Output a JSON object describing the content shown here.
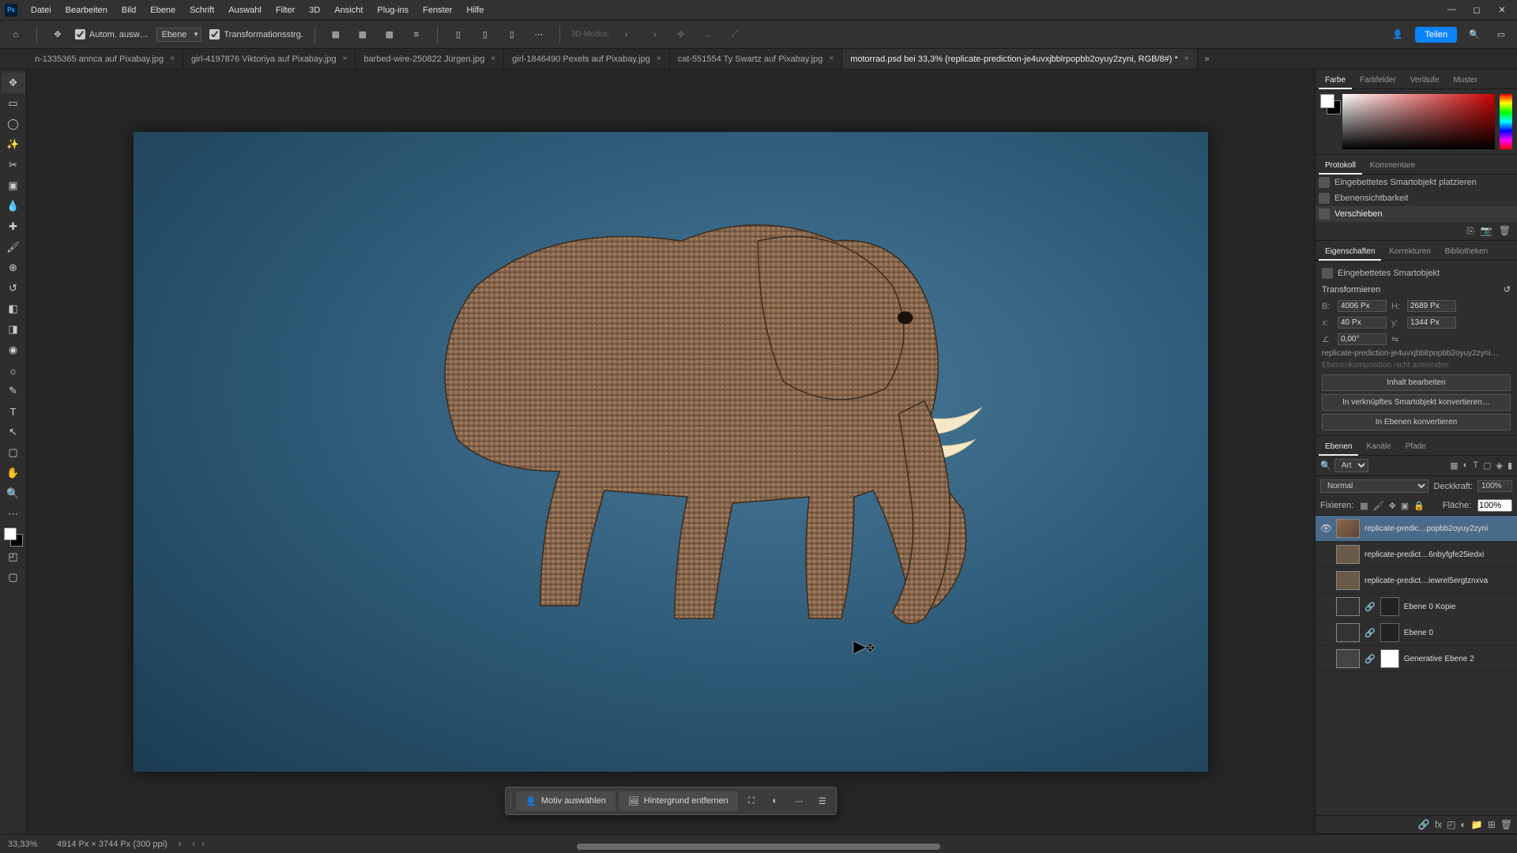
{
  "menu": [
    "Datei",
    "Bearbeiten",
    "Bild",
    "Ebene",
    "Schrift",
    "Auswahl",
    "Filter",
    "3D",
    "Ansicht",
    "Plug-ins",
    "Fenster",
    "Hilfe"
  ],
  "options": {
    "auto_select": "Autom. ausw…",
    "layer_dropdown": "Ebene",
    "transform_controls": "Transformationsstrg.",
    "mode3d": "3D-Modus:",
    "share": "Teilen"
  },
  "tabs": [
    {
      "label": "n-1335365 annca auf Pixabay.jpg",
      "active": false
    },
    {
      "label": "girl-4197876 Viktoriya auf Pixabay.jpg",
      "active": false
    },
    {
      "label": "barbed-wire-250822 Jürgen.jpg",
      "active": false
    },
    {
      "label": "girl-1846490 Pexels auf Pixabay.jpg",
      "active": false
    },
    {
      "label": "cat-551554 Ty Swartz auf Pixabay.jpg",
      "active": false
    },
    {
      "label": "motorrad.psd bei 33,3% (replicate-prediction-je4uvxjbblrpopbb2oyuy2zyni, RGB/8#) *",
      "active": true
    }
  ],
  "floating": {
    "select_subject": "Motiv auswählen",
    "remove_bg": "Hintergrund entfernen"
  },
  "panels": {
    "color_tabs": [
      "Farbe",
      "Farbfelder",
      "Verläufe",
      "Muster"
    ],
    "history_tabs": [
      "Protokoll",
      "Kommentare"
    ],
    "history_items": [
      {
        "label": "Eingebettetes Smartobjekt platzieren",
        "current": false
      },
      {
        "label": "Ebenensichtbarkeit",
        "current": false
      },
      {
        "label": "Verschieben",
        "current": true
      }
    ],
    "props_tabs": [
      "Eigenschaften",
      "Korrekturen",
      "Bibliotheken"
    ],
    "props": {
      "type_label": "Eingebettetes Smartobjekt",
      "transform_title": "Transformieren",
      "w_label": "B:",
      "w_value": "4006 Px",
      "h_label": "H:",
      "h_value": "2689 Px",
      "x_label": "x:",
      "x_value": "40 Px",
      "y_label": "y:",
      "y_value": "1344 Px",
      "angle": "0,00°",
      "filename": "replicate-prediction-je4uvxjbblrpopbb2oyuy2zyni…",
      "comp_note": "Ebenenkomposition nicht anwenden",
      "btn_edit": "Inhalt bearbeiten",
      "btn_linked": "In verknüpftes Smartobjekt konvertieren…",
      "btn_layers": "In Ebenen konvertieren"
    },
    "layer_tabs": [
      "Ebenen",
      "Kanäle",
      "Pfade"
    ],
    "layers_header": {
      "kind": "Art",
      "blend": "Normal",
      "opacity_label": "Deckkraft:",
      "opacity": "100%",
      "lock_label": "Fixieren:",
      "fill_label": "Fläche:",
      "fill": "100%"
    },
    "layers": [
      {
        "vis": true,
        "name": "replicate-predic…popbb2oyuy2zyni",
        "selected": true,
        "mask": false
      },
      {
        "vis": false,
        "name": "replicate-predict…6nbyfgfe25iedxi",
        "selected": false,
        "mask": false
      },
      {
        "vis": false,
        "name": "replicate-predict…iewrel5ergtznxva",
        "selected": false,
        "mask": false
      },
      {
        "vis": false,
        "name": "Ebene 0 Kopie",
        "selected": false,
        "mask": true
      },
      {
        "vis": false,
        "name": "Ebene 0",
        "selected": false,
        "mask": true
      },
      {
        "vis": false,
        "name": "Generative Ebene 2",
        "selected": false,
        "mask": true
      }
    ]
  },
  "status": {
    "zoom": "33,33%",
    "dims": "4914 Px × 3744 Px (300 ppi)"
  }
}
